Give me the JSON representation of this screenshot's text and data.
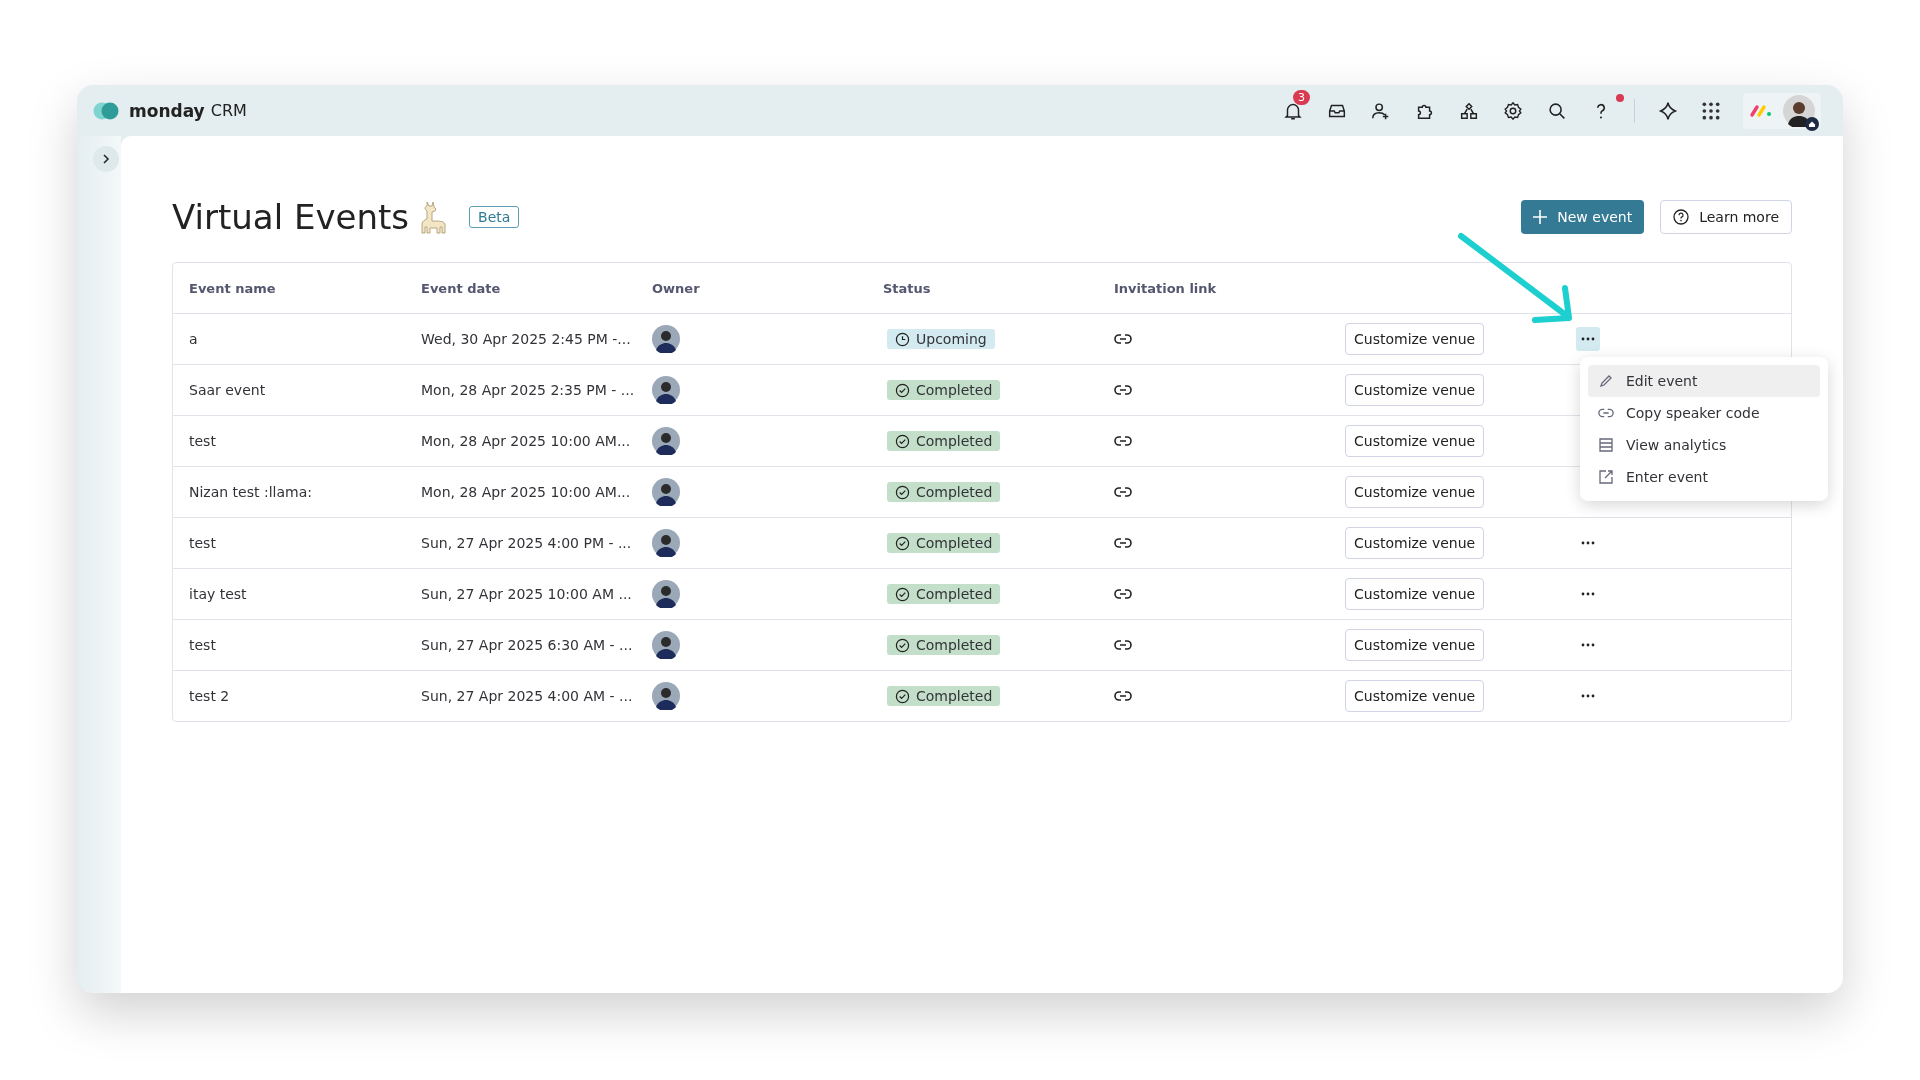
{
  "app": {
    "brand": "monday",
    "product": "CRM",
    "notifications": "3",
    "help_dot": true
  },
  "page": {
    "title": "Virtual Events",
    "badge": "Beta",
    "buttons": [
      {
        "kind": "primary",
        "label": "New event"
      },
      {
        "kind": "secondary",
        "label": "Learn more"
      }
    ]
  },
  "table": {
    "columns": [
      "Event name",
      "Event date",
      "Owner",
      "Status",
      "Invitation link"
    ],
    "rows": [
      {
        "name": "a",
        "date": "Wed, 30 Apr 2025 2:45 PM -...",
        "status": {
          "kind": "upcoming",
          "label": "Upcoming"
        },
        "action": "Customize venue",
        "menu_open": true
      },
      {
        "name": "Saar event",
        "date": "Mon, 28 Apr 2025 2:35 PM - ...",
        "status": {
          "kind": "completed",
          "label": "Completed"
        },
        "action": "Customize venue",
        "menu_open": false
      },
      {
        "name": "test",
        "date": "Mon, 28 Apr 2025 10:00 AM...",
        "status": {
          "kind": "completed",
          "label": "Completed"
        },
        "action": "Customize venue",
        "menu_open": false
      },
      {
        "name": "Nizan test :llama:",
        "date": "Mon, 28 Apr 2025 10:00 AM...",
        "status": {
          "kind": "completed",
          "label": "Completed"
        },
        "action": "Customize venue",
        "menu_open": false
      },
      {
        "name": "test",
        "date": "Sun, 27 Apr 2025 4:00 PM - ...",
        "status": {
          "kind": "completed",
          "label": "Completed"
        },
        "action": "Customize venue",
        "menu_open": false
      },
      {
        "name": "itay test",
        "date": "Sun, 27 Apr 2025 10:00 AM ...",
        "status": {
          "kind": "completed",
          "label": "Completed"
        },
        "action": "Customize venue",
        "menu_open": false
      },
      {
        "name": "test",
        "date": "Sun, 27 Apr 2025 6:30 AM - ...",
        "status": {
          "kind": "completed",
          "label": "Completed"
        },
        "action": "Customize venue",
        "menu_open": false
      },
      {
        "name": "test 2",
        "date": "Sun, 27 Apr 2025 4:00 AM - ...",
        "status": {
          "kind": "completed",
          "label": "Completed"
        },
        "action": "Customize venue",
        "menu_open": false
      }
    ]
  },
  "menu": {
    "items": [
      {
        "kind": "edit",
        "label": "Edit event",
        "selected": true
      },
      {
        "kind": "link",
        "label": "Copy speaker code",
        "selected": false
      },
      {
        "kind": "analytics",
        "label": "View analytics",
        "selected": false
      },
      {
        "kind": "external",
        "label": "Enter event",
        "selected": false
      }
    ]
  }
}
